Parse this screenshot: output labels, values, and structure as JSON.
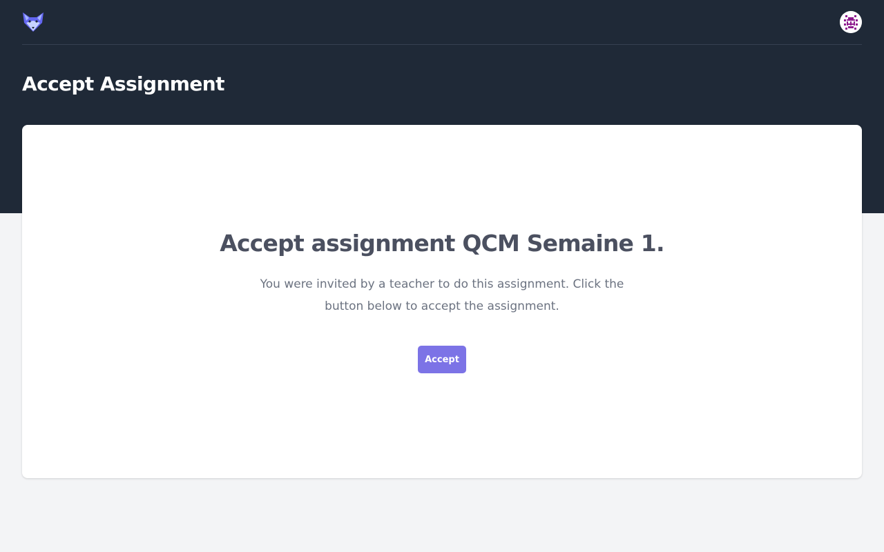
{
  "header": {
    "logo_icon": "fox-logo-icon",
    "avatar_icon": "user-avatar-icon"
  },
  "page": {
    "title": "Accept Assignment"
  },
  "card": {
    "heading": "Accept assignment QCM Semaine 1.",
    "description": "You were invited by a teacher to do this assignment. Click the button below to accept the assignment.",
    "accept_label": "Accept"
  },
  "colors": {
    "header_bg": "#1f2937",
    "page_bg": "#f3f4f6",
    "accent": "#7c73e6",
    "heading_text": "#4b5060",
    "body_text": "#6b7280"
  }
}
